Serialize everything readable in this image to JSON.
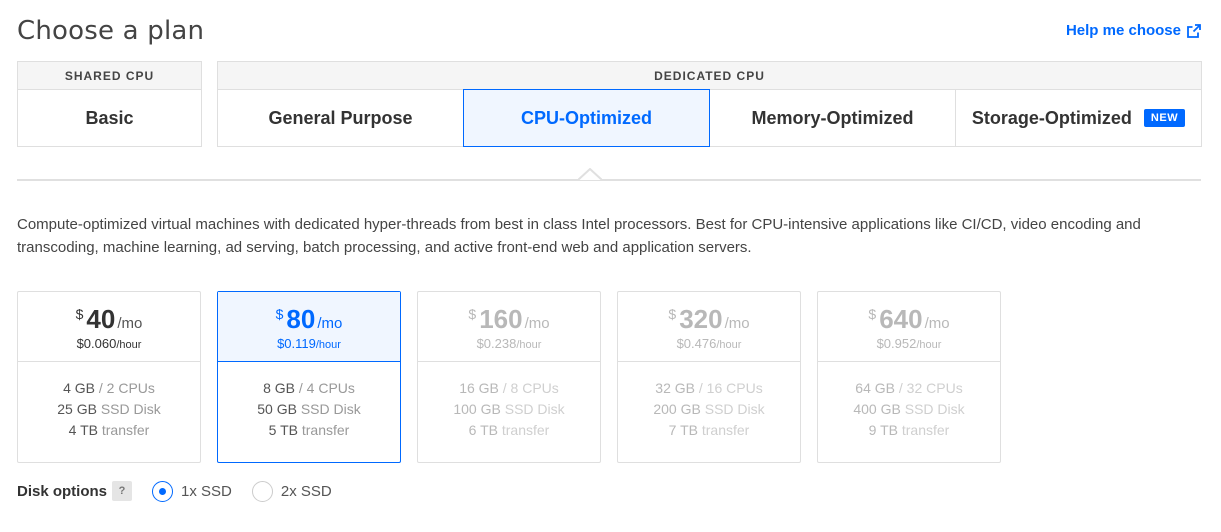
{
  "header": {
    "title": "Choose a plan",
    "help_link": "Help me choose"
  },
  "plan_groups": {
    "shared": {
      "label": "SHARED CPU",
      "tabs": [
        "Basic"
      ]
    },
    "dedicated": {
      "label": "DEDICATED CPU",
      "tabs": [
        "General Purpose",
        "CPU-Optimized",
        "Memory-Optimized",
        "Storage-Optimized"
      ],
      "new_badge": "NEW"
    },
    "active_tab": "CPU-Optimized"
  },
  "description": "Compute-optimized virtual machines with dedicated hyper-threads from best in class Intel processors. Best for CPU-intensive applications like CI/CD, video encoding and transcoding, machine learning, ad serving, batch processing, and active front-end web and application servers.",
  "plans": [
    {
      "currency": "$",
      "price": "40",
      "per": "/mo",
      "hourly": "$0.060",
      "hour_unit": "/hour",
      "memory": "4 GB",
      "cpus": "/ 2 CPUs",
      "disk": "25 GB",
      "disk_unit": "SSD Disk",
      "transfer": "4 TB",
      "transfer_unit": "transfer",
      "state": "available"
    },
    {
      "currency": "$",
      "price": "80",
      "per": "/mo",
      "hourly": "$0.119",
      "hour_unit": "/hour",
      "memory": "8 GB",
      "cpus": "/ 4 CPUs",
      "disk": "50 GB",
      "disk_unit": "SSD Disk",
      "transfer": "5 TB",
      "transfer_unit": "transfer",
      "state": "selected"
    },
    {
      "currency": "$",
      "price": "160",
      "per": "/mo",
      "hourly": "$0.238",
      "hour_unit": "/hour",
      "memory": "16 GB",
      "cpus": "/ 8 CPUs",
      "disk": "100 GB",
      "disk_unit": "SSD Disk",
      "transfer": "6 TB",
      "transfer_unit": "transfer",
      "state": "disabled"
    },
    {
      "currency": "$",
      "price": "320",
      "per": "/mo",
      "hourly": "$0.476",
      "hour_unit": "/hour",
      "memory": "32 GB",
      "cpus": "/ 16 CPUs",
      "disk": "200 GB",
      "disk_unit": "SSD Disk",
      "transfer": "7 TB",
      "transfer_unit": "transfer",
      "state": "disabled"
    },
    {
      "currency": "$",
      "price": "640",
      "per": "/mo",
      "hourly": "$0.952",
      "hour_unit": "/hour",
      "memory": "64 GB",
      "cpus": "/ 32 CPUs",
      "disk": "400 GB",
      "disk_unit": "SSD Disk",
      "transfer": "9 TB",
      "transfer_unit": "transfer",
      "state": "disabled"
    }
  ],
  "disk_options": {
    "label": "Disk options",
    "help": "?",
    "options": [
      "1x SSD",
      "2x SSD"
    ],
    "selected": "1x SSD"
  },
  "colors": {
    "accent": "#0069ff",
    "selected_bg": "#f0f6ff",
    "border": "#dfdfdf"
  },
  "icons": {
    "help_link": "external-link-icon",
    "tab_pointer": "caret-up-icon"
  }
}
